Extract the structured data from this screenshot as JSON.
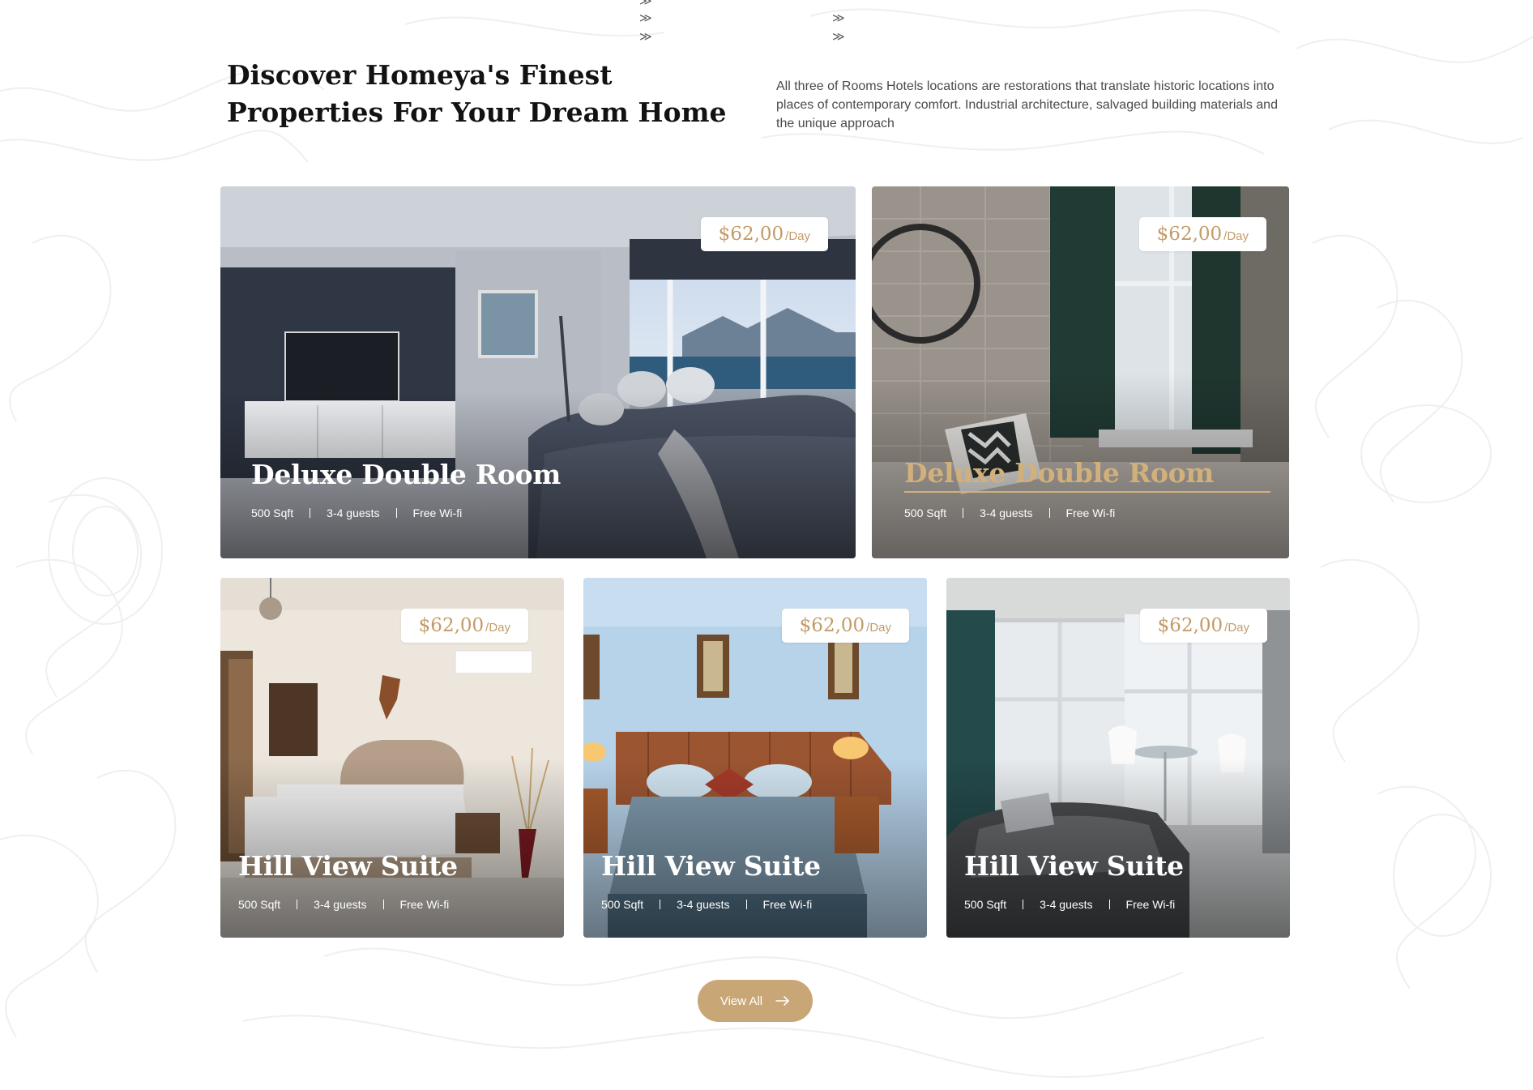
{
  "header": {
    "title": "Discover Homeya's Finest Properties For Your Dream Home",
    "description": "All three of Rooms Hotels locations are restorations that translate historic locations into places of contemporary comfort. Industrial architecture, salvaged building materials and the unique approach"
  },
  "decor": {
    "chevron": "≫"
  },
  "rooms": [
    {
      "title": "Deluxe Double Room",
      "price": "$62,00",
      "per": "/Day",
      "features": [
        "500 Sqft",
        "3-4 guests",
        "Free Wi-fi"
      ]
    },
    {
      "title": "Deluxe Double Room",
      "price": "$62,00",
      "per": "/Day",
      "features": [
        "500 Sqft",
        "3-4 guests",
        "Free Wi-fi"
      ]
    },
    {
      "title": "Hill View Suite",
      "price": "$62,00",
      "per": "/Day",
      "features": [
        "500 Sqft",
        "3-4 guests",
        "Free Wi-fi"
      ]
    },
    {
      "title": "Hill View Suite",
      "price": "$62,00",
      "per": "/Day",
      "features": [
        "500 Sqft",
        "3-4 guests",
        "Free Wi-fi"
      ]
    },
    {
      "title": "Hill View Suite",
      "price": "$62,00",
      "per": "/Day",
      "features": [
        "500 Sqft",
        "3-4 guests",
        "Free Wi-fi"
      ]
    }
  ],
  "cta": {
    "label": "View All",
    "icon": "arrow-right-icon"
  },
  "colors": {
    "accent": "#c9a676",
    "price_text": "#c39b68",
    "heading": "#121212",
    "body_text": "#4a4a4a"
  }
}
